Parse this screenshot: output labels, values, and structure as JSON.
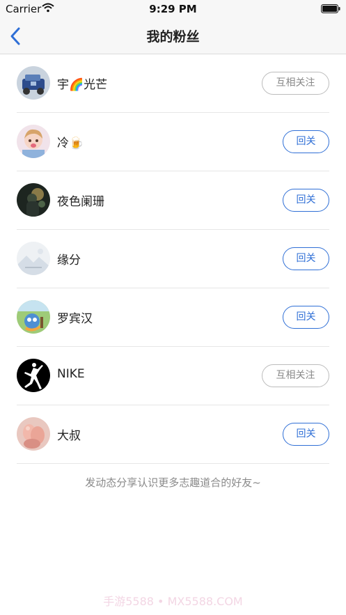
{
  "status_bar": {
    "carrier": "Carrier",
    "time": "9:29 PM"
  },
  "nav": {
    "title": "我的粉丝",
    "back_icon": "chevron-left-icon"
  },
  "accent_color": "#2f6fd6",
  "fans": [
    {
      "name": "宇🌈光芒",
      "button": "互相关注",
      "state": "mutual"
    },
    {
      "name": "冷🍺",
      "button": "回关",
      "state": "follow-back"
    },
    {
      "name": "夜色阑珊",
      "button": "回关",
      "state": "follow-back"
    },
    {
      "name": "缘分",
      "button": "回关",
      "state": "follow-back"
    },
    {
      "name": "罗宾汉",
      "button": "回关",
      "state": "follow-back"
    },
    {
      "name": "NIKE",
      "button": "互相关注",
      "state": "mutual"
    },
    {
      "name": "大叔",
      "button": "回关",
      "state": "follow-back"
    }
  ],
  "footer_tip": "发动态分享认识更多志趣道合的好友~",
  "watermark": "手游5588 • MX5588.COM"
}
